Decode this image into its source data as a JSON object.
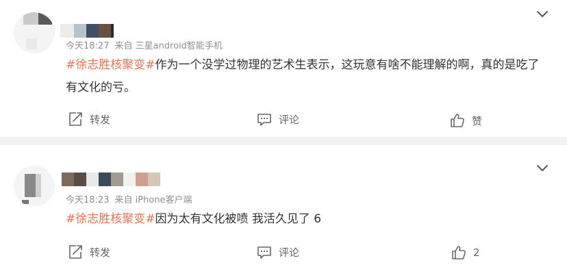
{
  "comments": [
    {
      "time": "今天18:27",
      "source": "来自 三星android智能手机",
      "topic": "#徐志胜核聚变#",
      "text": "作为一个没学过物理的艺术生表示，这玩意有啥不能理解的啊，真的是吃了有文化的亏。",
      "actions": {
        "repost": "转发",
        "comment": "评论",
        "like": "赞"
      }
    },
    {
      "time": "今天18:23",
      "source": "来自 iPhone客户端",
      "topic": "#徐志胜核聚变#",
      "text": "因为太有文化被喷 我活久见了 6",
      "actions": {
        "repost": "转发",
        "comment": "评论",
        "like": "2"
      }
    }
  ],
  "icons": {
    "expand": "chevron-down-icon",
    "repost": "share-icon",
    "comment": "comment-icon",
    "like": "thumbs-up-icon"
  },
  "colors": {
    "topic": "#eb7350",
    "meta": "#8f8f8f",
    "action": "#666666",
    "background": "#f2f2f2"
  }
}
